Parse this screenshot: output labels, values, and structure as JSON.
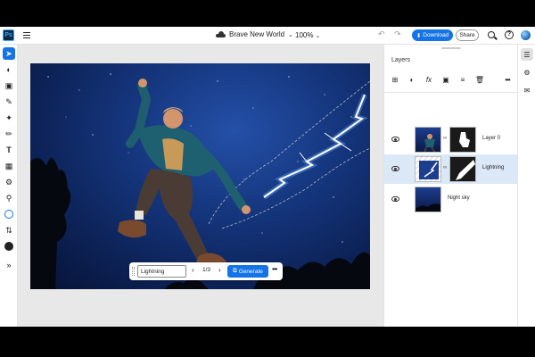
{
  "app": {
    "logo": "Ps"
  },
  "topbar": {
    "doc_title": "Brave New World",
    "zoom": "100%",
    "download_label": "Download",
    "share_label": "Share"
  },
  "context_bar": {
    "prompt_value": "Lightning",
    "counter": "1/3",
    "generate_label": "Generate"
  },
  "layers": {
    "title": "Layers",
    "items": [
      {
        "name": "Layer 0",
        "selected": false
      },
      {
        "name": "Lightning",
        "selected": true
      },
      {
        "name": "Night sky",
        "selected": false
      }
    ]
  },
  "colors": {
    "accent": "#1473e6",
    "selected_row": "#dbe8f8",
    "sky": "#14347a"
  },
  "icons": {
    "toolbar": [
      "select-icon",
      "adjustment-icon",
      "crop-icon",
      "brush-icon",
      "heal-icon",
      "paint-icon",
      "type-icon",
      "image-icon",
      "clone-icon",
      "eyedropper-icon",
      "color-swatch-icon",
      "swap-icon",
      "foreground-color-icon",
      "expand-icon"
    ],
    "right_rail": [
      "layers-icon",
      "adjustments-icon",
      "comments-icon"
    ]
  }
}
